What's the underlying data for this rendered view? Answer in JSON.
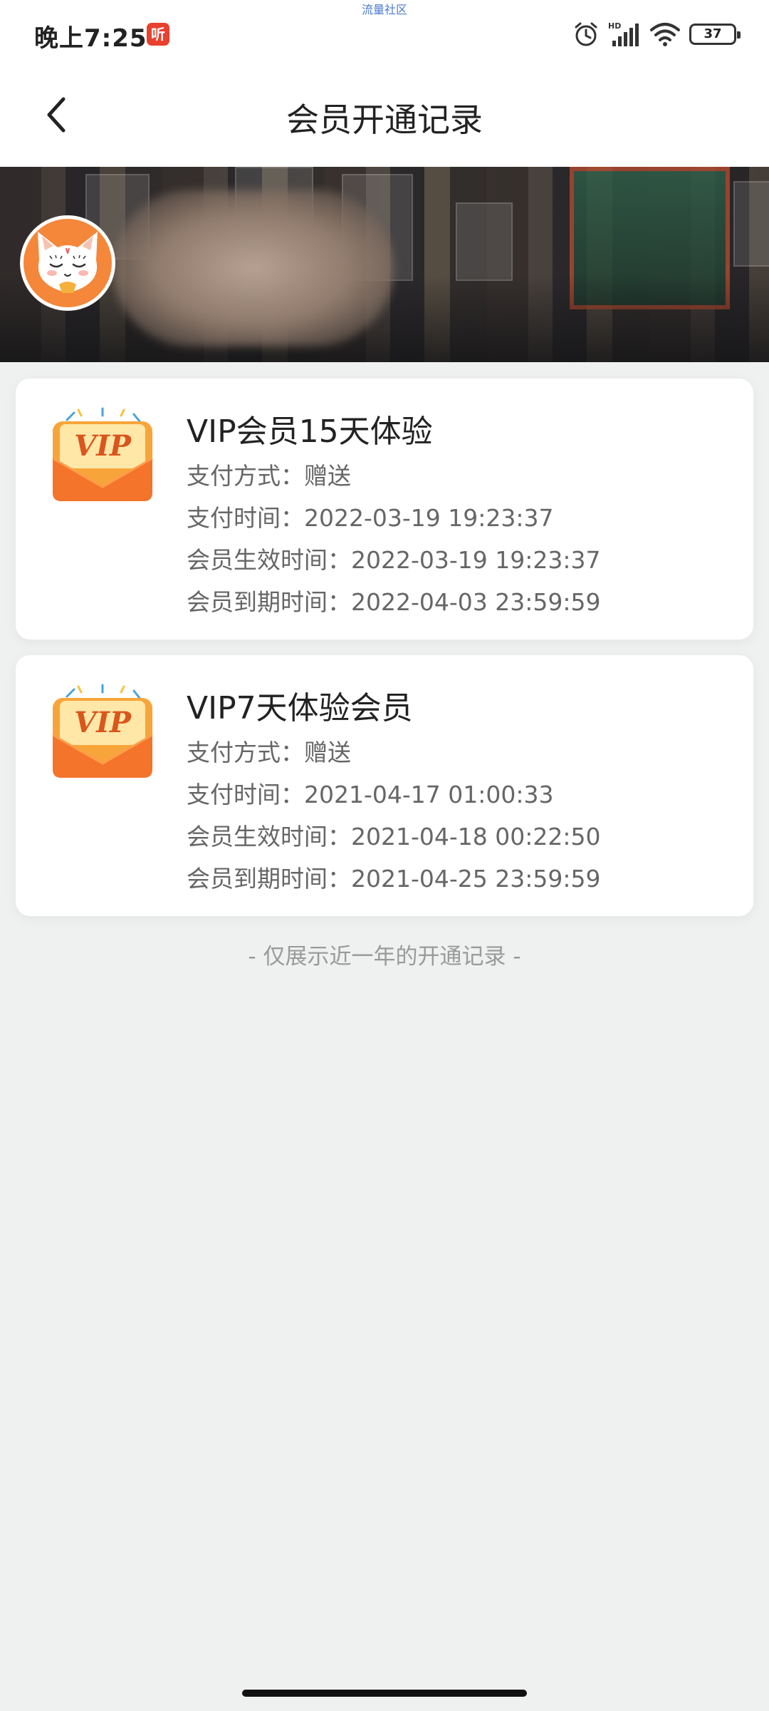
{
  "status_bar": {
    "time": "晚上7:25",
    "app_badge": "听",
    "watermark": "流量社区",
    "battery": "37",
    "icons": [
      "alarm-icon",
      "hd-signal-icon",
      "wifi-icon",
      "battery-icon"
    ]
  },
  "nav": {
    "title": "会员开通记录",
    "back_icon": "chevron-left-icon"
  },
  "records": [
    {
      "title": "VIP会员15天体验",
      "payment_method": "支付方式：赠送",
      "payment_time": "支付时间：2022-03-19 19:23:37",
      "effective_time": "会员生效时间：2022-03-19 19:23:37",
      "expire_time": "会员到期时间：2022-04-03 23:59:59"
    },
    {
      "title": "VIP7天体验会员",
      "payment_method": "支付方式：赠送",
      "payment_time": "支付时间：2021-04-17 01:00:33",
      "effective_time": "会员生效时间：2021-04-18 00:22:50",
      "expire_time": "会员到期时间：2021-04-25 23:59:59"
    }
  ],
  "vip_badge_text": "VIP",
  "footer_note": "- 仅展示近一年的开通记录 -",
  "colors": {
    "accent": "#f4873a",
    "background": "#eff1f0",
    "card": "#ffffff",
    "badge": "#e8412e"
  }
}
